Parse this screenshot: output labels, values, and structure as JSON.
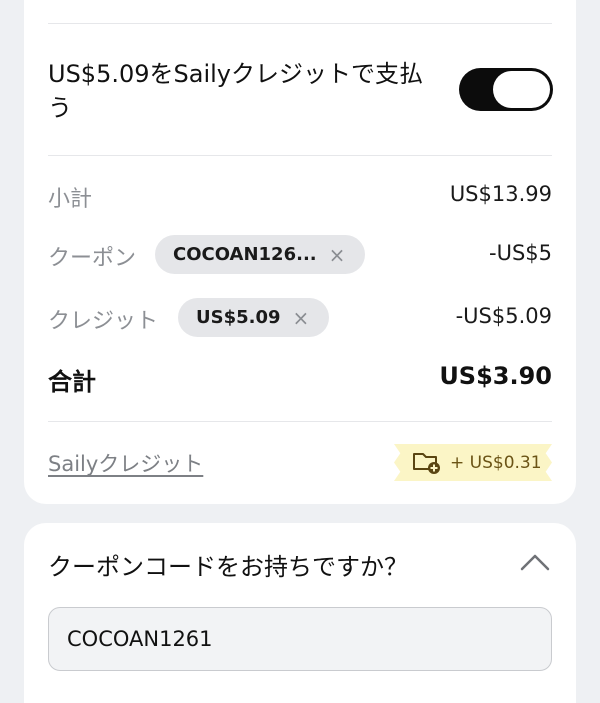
{
  "payment": {
    "credit_toggle_label": "US$5.09をSailyクレジットで支払う",
    "credit_toggle_on": true
  },
  "summary": {
    "subtotal_label": "小計",
    "subtotal_value": "US$13.99",
    "coupon_label": "クーポン",
    "coupon_chip": "COCOAN126...",
    "coupon_value": "-US$5",
    "credit_label": "クレジット",
    "credit_chip": "US$5.09",
    "credit_value": "-US$5.09",
    "total_label": "合計",
    "total_value": "US$3.90"
  },
  "saily_credit": {
    "link_label": "Sailyクレジット",
    "earned": "+ US$0.31"
  },
  "coupon_section": {
    "question": "クーポンコードをお持ちですか？",
    "input_value": "COCOAN1261"
  },
  "icons": {
    "remove": "×"
  },
  "colors": {
    "toggle_on": "#0c0c0c",
    "badge_bg": "#fbf5c6",
    "badge_text": "#6b5416",
    "muted_text": "#8c8f94"
  }
}
